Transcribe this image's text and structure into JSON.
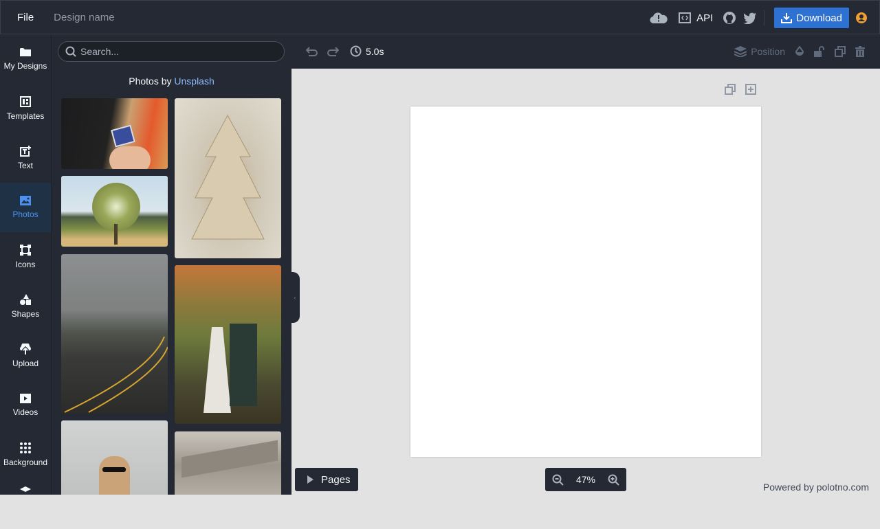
{
  "topbar": {
    "file_label": "File",
    "design_name": "Design name",
    "api_label": "API",
    "download_label": "Download",
    "icons": [
      "cloud-warning-icon",
      "code-icon",
      "github-icon",
      "twitter-icon",
      "download-icon",
      "user-icon"
    ]
  },
  "sidebar": {
    "items": [
      {
        "label": "My Designs",
        "icon": "folder-icon"
      },
      {
        "label": "Templates",
        "icon": "templates-icon"
      },
      {
        "label": "Text",
        "icon": "text-icon"
      },
      {
        "label": "Photos",
        "icon": "photo-icon",
        "active": true
      },
      {
        "label": "Icons",
        "icon": "icons-icon"
      },
      {
        "label": "Shapes",
        "icon": "shapes-icon"
      },
      {
        "label": "Upload",
        "icon": "upload-icon"
      },
      {
        "label": "Videos",
        "icon": "video-icon"
      },
      {
        "label": "Background",
        "icon": "grid-icon"
      }
    ]
  },
  "panel": {
    "search_placeholder": "Search...",
    "credit_prefix": "Photos by",
    "credit_link": "Unsplash",
    "photos": [
      {
        "subject": "camera with memory card",
        "colors": [
          "#1c1c1e",
          "#e8b07a",
          "#e45a2c"
        ]
      },
      {
        "subject": "paper christmas tree",
        "colors": [
          "#cfc6b4",
          "#bfae90",
          "#e2dccf"
        ]
      },
      {
        "subject": "oak tree in field",
        "colors": [
          "#c6dbe8",
          "#7e8f45",
          "#d6b77a"
        ]
      },
      {
        "subject": "foggy road",
        "colors": [
          "#8d8f90",
          "#4e524b",
          "#2b2b2a"
        ]
      },
      {
        "subject": "couple walking",
        "colors": [
          "#6d7a3c",
          "#c6763a",
          "#e6e4dc"
        ]
      },
      {
        "subject": "woman in sunglasses",
        "colors": [
          "#d0d3d1",
          "#b9bcba",
          "#caa478"
        ]
      },
      {
        "subject": "abstract sculpture",
        "colors": [
          "#c9c4bc",
          "#9c958b",
          "#b8b2a8"
        ]
      }
    ]
  },
  "toolbar": {
    "duration": "5.0s",
    "position_label": "Position"
  },
  "canvas": {
    "pages_label": "Pages",
    "zoom_level": "47%",
    "powered_by": "Powered by polotno.com"
  }
}
